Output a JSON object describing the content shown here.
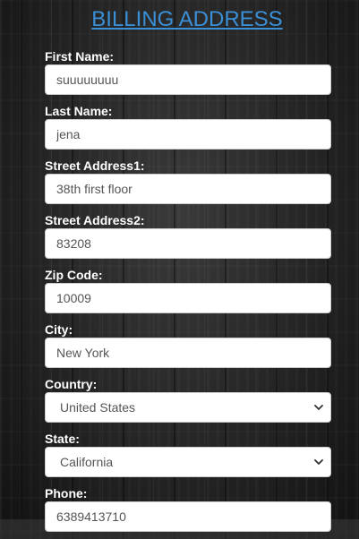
{
  "title": "BILLING ADDRESS",
  "fields": {
    "first_name": {
      "label": "First Name:",
      "value": "suuuuuuuu"
    },
    "last_name": {
      "label": "Last Name:",
      "value": "jena"
    },
    "street1": {
      "label": "Street Address1:",
      "value": "38th first floor"
    },
    "street2": {
      "label": "Street Address2:",
      "value": "83208"
    },
    "zip": {
      "label": "Zip Code:",
      "value": "10009"
    },
    "city": {
      "label": "City:",
      "value": "New York"
    },
    "country": {
      "label": "Country:",
      "value": "United States"
    },
    "state": {
      "label": "State:",
      "value": "California"
    },
    "phone": {
      "label": "Phone:",
      "value": "6389413710"
    }
  },
  "icons": {
    "country_dropdown": "chevron-down-icon",
    "state_dropdown": "chevron-down-icon"
  },
  "colors": {
    "title_link": "#3a8fd6",
    "label_text": "#ffffff",
    "input_text": "#555555",
    "input_border": "#cccccc"
  }
}
